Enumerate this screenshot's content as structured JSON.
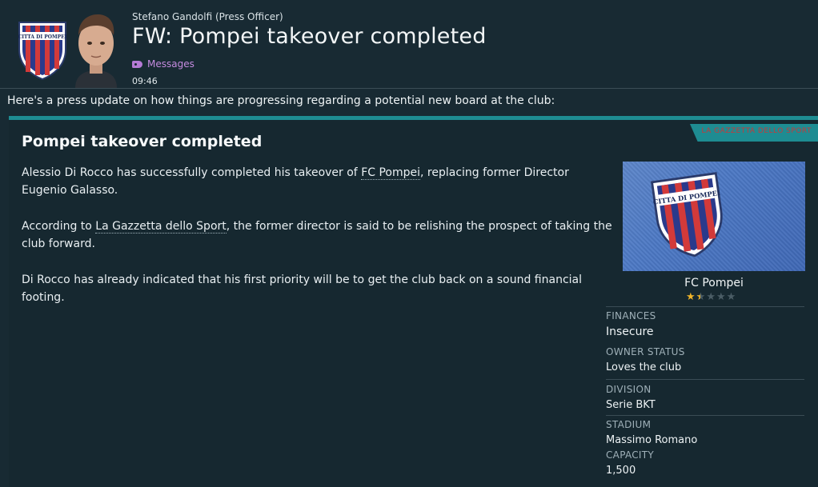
{
  "header": {
    "sender": "Stefano Gandolfi  (Press Officer)",
    "title": "FW: Pompei takeover completed",
    "category": "Messages",
    "time": "09:46"
  },
  "intro": "Here's a press update on how things are progressing regarding a potential new board at the club:",
  "article": {
    "source_ribbon": "LA GAZZETTA DELLO SPORT",
    "headline": "Pompei takeover completed",
    "p1_a": "Alessio Di Rocco has successfully completed his takeover of ",
    "p1_link": "FC Pompei",
    "p1_b": ", replacing former Director Eugenio Galasso.",
    "p2_a": "According to ",
    "p2_link": "La Gazzetta dello Sport",
    "p2_b": ", the former director is said to be relishing the prospect of taking the club forward.",
    "p3": "Di Rocco has already indicated that his first priority will be to get the club back on a sound financial footing."
  },
  "club": {
    "name": "FC Pompei",
    "crest_text": "CITTA DI POMPEI",
    "reputation_stars": 1.5,
    "reputation_max": 5,
    "finances_label": "FINANCES",
    "finances_value": "Insecure",
    "owner_label": "OWNER STATUS",
    "owner_value": "Loves the club",
    "division_label": "DIVISION",
    "division_value": "Serie BKT",
    "stadium_label": "STADIUM",
    "stadium_value": "Massimo Romano",
    "capacity_label": "CAPACITY",
    "capacity_value": "1,500"
  },
  "colors": {
    "background": "#182a33",
    "accent": "#1e8c92",
    "category": "#c58be0",
    "star": "#f0b429"
  },
  "icons": {
    "category": "tag-icon",
    "sender": "avatar"
  }
}
